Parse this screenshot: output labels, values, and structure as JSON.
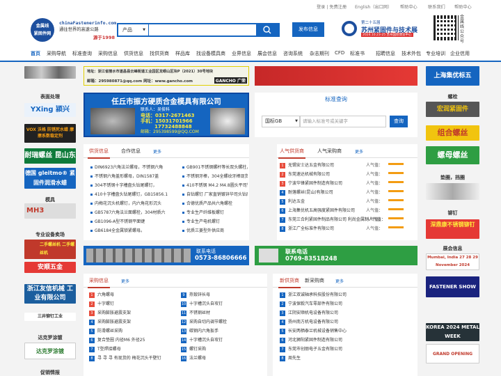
{
  "top_links": {
    "login": "登录 | 免费注册",
    "english": "English（出口网）",
    "help1": "帮助中心",
    "contact": "联系我们",
    "help2": "帮助中心"
  },
  "logo": {
    "line1": "金属线",
    "line2": "紧固件网"
  },
  "brand": {
    "domain": "chinaFastenerinfo.com",
    "slogan": "通往世界的高速公路",
    "since": "源于1998"
  },
  "search": {
    "category": "产品",
    "placeholder": ""
  },
  "publish_button": "发布信息",
  "expo": {
    "line1": "第二十五届",
    "line2": "苏州紧固件与技术展",
    "line3": "2024.10.23-25 苏州国际博览中心"
  },
  "qr_caption": "金属线公众号",
  "nav": [
    "首页",
    "采购导航",
    "标准查询",
    "采购信息",
    "供货信息",
    "找供货商",
    "样品库",
    "找设备模具商",
    "业界信息",
    "展会信息",
    "咨询系统",
    "杂志期刊",
    "CFD",
    "标准书",
    "招聘信息",
    "技术外包",
    "专业培训",
    "企业信用"
  ],
  "left_sidebar": {
    "section_surface": "表面处理",
    "ad_yixing": "YXing 颍兴",
    "ad_vox": "VOX 沃格 防锈死水蜡 摩擦系数稳定剂",
    "ad_nirui": "耐瑞螺丝 昆山东莞",
    "ad_gleitmo": "德国 gleitmo® 紧固件润滑水蜡",
    "section_mold": "模具",
    "ad_mh3": "MH3",
    "section_equipment": "专业设备卖场",
    "ad_equip": "二手螺丝机 二手螺丝机",
    "ad_anshun": "安顺五金",
    "ad_zhejiang": "浙江友信机械 工业有限公司",
    "ad_sanjing": "三井铆钉工业",
    "section_dakelong": "达克罗涂镀",
    "ad_dakelong": "达克罗涂镀",
    "section_tip": "促销情报"
  },
  "top_banner": {
    "address": "地址：浙江省丽水市遂昌县云峰街道工业园区龙眼山区块P（2021）30号地块",
    "email": "邮箱：295980871@qq.com  网址：www.gancho.com",
    "brand": "GANCHO 广荣"
  },
  "company_banner": {
    "name": "任丘市振方硬质合金模具有限公司",
    "contact": "联系人：吴俊科",
    "phone": "电话：0317-2671463",
    "mobile1": "手机：15031701966",
    "mobile2": "17732488848",
    "email": "邮箱：295398599@QQ.COM"
  },
  "standard_query": {
    "title": "标准查询",
    "select": "国标GB",
    "placeholder": "请输入标准号或关键字",
    "button": "查询"
  },
  "supply_panel": {
    "tabs": [
      "供货信息",
      "合作信息"
    ],
    "more": "更多",
    "left": [
      "DIN6923六角法兰螺母，不锈钢六角",
      "不锈钢六角盖形螺母，DIN1587盖",
      "304不锈钢十字槽盘头钻尾螺钉，",
      "410十字槽盘头钻尾螺钉，GB15856.1",
      "内梅花沉头机螺钉，内六角花形沉头",
      "GB5787六角法兰面螺栓，304材质六",
      "GB1096-A型不锈钢平面键",
      "GB6184全金属锁紧螺母。"
    ],
    "right": [
      "GB901不锈钢螺杆等长双头螺柱，304",
      "不锈钢牙棒，304全螺纹牙棒现货，",
      "410不锈钢 M4.2 M4.8圆头平司钻尾",
      "自钻螺钉 厂家直销镀锌华司头钻尾/",
      "合德优质产品共六角螺栓",
      "专业生产纤维板螺钉",
      "专业生产电机螺钉",
      "优质三菱型外供应商"
    ]
  },
  "popular_panel": {
    "tabs": [
      "人气供货商",
      "人气采购商"
    ],
    "more": "更多",
    "heat_label": "人气值：",
    "items": [
      "无锡安士达五金有限公司",
      "东莞速达机械有限公司",
      "宁波华锋紧固件制造有限公司",
      "耐落螺丝(昆山)有限公司",
      "利达五金",
      "上海集优机五高强度紧固件有限公司",
      "东莞三合利紧固件制品有限公司 利尚金属制人气值：",
      "浙江广全标准件有限公司"
    ]
  },
  "hotline_banners": {
    "left_label": "联系电话",
    "left_phone": "0573-86806666",
    "right_label": "联系电话",
    "right_phone": "0769-83518248"
  },
  "purchase_panel": {
    "tabs": [
      "采购信息"
    ],
    "more": "更多",
    "left": [
      "六角螺母",
      "十字螺钉",
      "采购膨胀避震支架",
      "采购膨胀避震支架",
      "防滑螺丝采购",
      "复合垫圈 内径M6 外径25",
      "T型焊接螺母",
      "寻 寻 寻 有现货的 梅花沉头干壁钉"
    ],
    "right": [
      "热锻锌长母",
      "十字槽沉头自攻钉",
      "不锈钢丝材",
      "采购自切内调节螺栓",
      "碳钢内六角扳手",
      "十字槽沉头自攻钉",
      "螺钉采购",
      "法兰螺母"
    ]
  },
  "newsupply_panel": {
    "tabs": [
      "新供货商",
      "新采购商"
    ],
    "more": "更多",
    "items": [
      "浙江双诚轴承科技股份有限公司",
      "宁波保毅汽车零部件有限公司",
      "江阴安顺机电设备有限公司",
      "扬州南方机电设备有限公司",
      "长安两栖泰兰机械设备销售中心",
      "河北狮阳紧固件制造有限公司",
      "东莞市创丽电子五金有限公司",
      "周先生"
    ]
  },
  "right_sidebar": {
    "ad_jiyou": "上海集优标五",
    "section_bolt": "螺栓",
    "ad_hongrun": "宏润紧固件",
    "ad_zuhe": "组合螺丝",
    "ad_luomao": "螺母螺丝",
    "section_washer": "垫圈，挡圈",
    "section_rivet": "铆钉",
    "ad_rivet": "深鼎康不锈钢铆钉",
    "section_expo": "展会信息",
    "ad_expo1": "Mumbai, India 27 28 29 November 2024",
    "ad_expo2": "FASTENER SHOW",
    "ad_expo3": "KOREA 2024 METAL WEEK",
    "ad_expo4": "GRAND OPENING"
  }
}
